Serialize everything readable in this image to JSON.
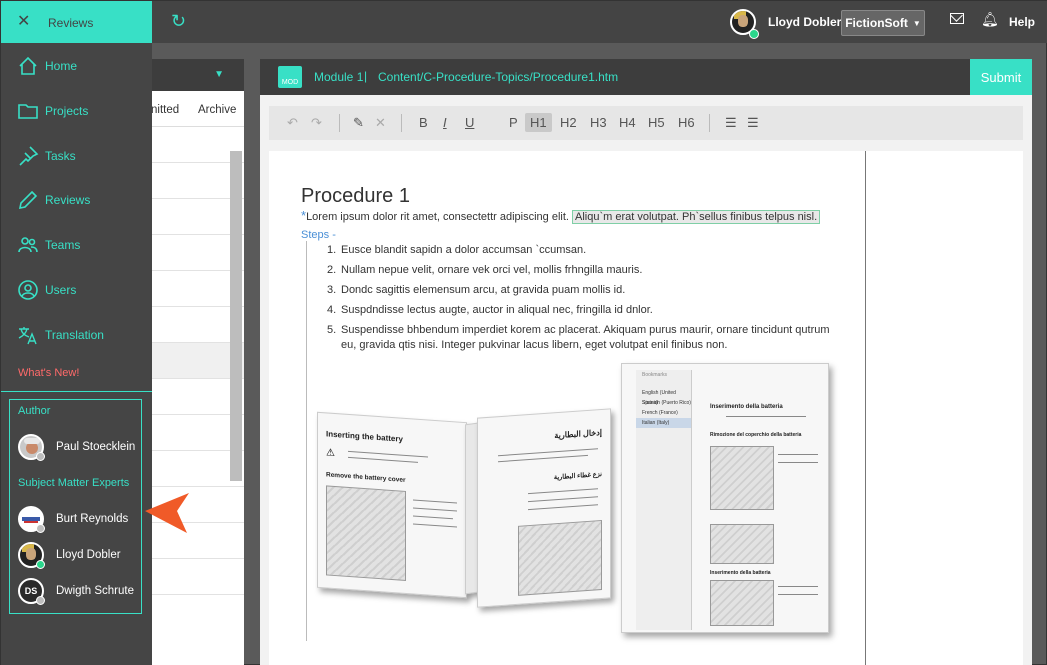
{
  "menu": {
    "title": "Reviews",
    "items": [
      {
        "label": "Home",
        "icon": "home-icon"
      },
      {
        "label": "Projects",
        "icon": "folder-icon"
      },
      {
        "label": "Tasks",
        "icon": "pin-icon"
      },
      {
        "label": "Reviews",
        "icon": "pen-icon"
      },
      {
        "label": "Teams",
        "icon": "team-icon"
      },
      {
        "label": "Users",
        "icon": "user-icon"
      },
      {
        "label": "Translation",
        "icon": "translate-icon"
      }
    ],
    "whats_new": "What's New!",
    "author_heading": "Author",
    "author": "Paul Stoecklein",
    "sme_heading": "Subject Matter Experts",
    "sme": [
      "Burt Reynolds",
      "Lloyd Dobler",
      "Dwigth Schrute"
    ],
    "sme_initials": "DS"
  },
  "topbar": {
    "user": "Lloyd Dobler",
    "org": "FictionSoft",
    "help": "Help"
  },
  "midpanel": {
    "tab_left": "nitted",
    "tab_right": "Archive"
  },
  "editor": {
    "mod_icon": "MOD",
    "module": "Module 1",
    "separator": "|",
    "path": "Content/C-Procedure-Topics/Procedure1.htm",
    "submit": "Submit",
    "toolbar": {
      "bold": "B",
      "italic": "I",
      "underline": "U",
      "p": "P",
      "h1": "H1",
      "h2": "H2",
      "h3": "H3",
      "h4": "H4",
      "h5": "H5",
      "h6": "H6"
    },
    "doc": {
      "title": "Procedure 1",
      "intro": "Lorem ipsum dolor rit amet, consectettr adipiscing elit.",
      "highlight": "Aliqu`m erat volutpat. Ph`sellus finibus telpus nisl.",
      "steps_label": "Steps",
      "steps": [
        "Eusce blandit sapidn a dolor accumsan `ccumsan.",
        "Nullam nepue velit, ornare vek orci vel, mollis frhngilla mauris.",
        "Dondc sagittis elemensum arcu, at gravida puam mollis id.",
        "Suspdndisse lectus augte, auctor in aliqual nec, fringilla id dnlor.",
        "Suspendisse bhbendum imperdiet korem ac placerat. Akiquam purus maurir, ornare tincidunt qutrum eu, gravida qtis nisi. Integer pukvinar lacus libern, eget volutpat enil finibus non."
      ]
    },
    "manual": {
      "title_en": "Inserting the battery",
      "sub_en": "Remove the battery cover",
      "title_ar": "إدخال البطارية",
      "sub_ar": "نزع غطاء البطارية",
      "title_it": "Inserimento della batteria",
      "sub_it": "Rimozione del coperchio della batteria",
      "title_it2": "Inserimento della batteria",
      "lang_panel_header": "Bookmarks",
      "languages": [
        "English (United States)",
        "Spanish (Puerto Rico)",
        "French (France)",
        "Italian (Italy)"
      ]
    }
  },
  "colors": {
    "accent": "#38e0c6",
    "alert": "#ff6a6a",
    "arrow": "#f05a28"
  }
}
